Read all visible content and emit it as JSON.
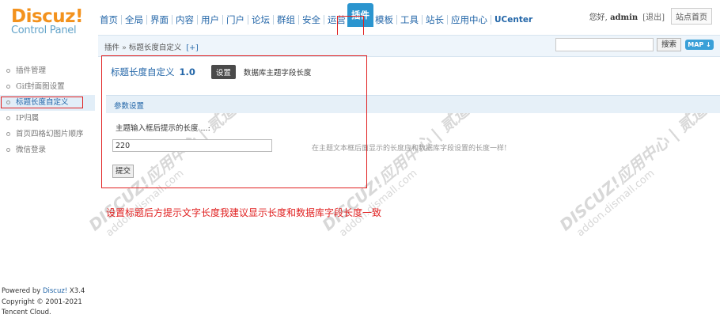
{
  "header": {
    "logo_title": "Discuz!",
    "logo_subtitle": "Control Panel",
    "nav": [
      {
        "label": "首页",
        "active": false
      },
      {
        "label": "全局",
        "active": false
      },
      {
        "label": "界面",
        "active": false
      },
      {
        "label": "内容",
        "active": false
      },
      {
        "label": "用户",
        "active": false
      },
      {
        "label": "门户",
        "active": false
      },
      {
        "label": "论坛",
        "active": false
      },
      {
        "label": "群组",
        "active": false
      },
      {
        "label": "安全",
        "active": false
      },
      {
        "label": "运营",
        "active": false
      },
      {
        "label": "插件",
        "active": true
      },
      {
        "label": "模板",
        "active": false
      },
      {
        "label": "工具",
        "active": false
      },
      {
        "label": "站长",
        "active": false
      },
      {
        "label": "应用中心",
        "active": false
      },
      {
        "label": "UCenter",
        "active": false
      }
    ],
    "welcome_prefix": "您好,",
    "username": "admin",
    "logout": "[退出]",
    "site_home": "站点首页"
  },
  "subbar": {
    "breadcrumb": "插件 » 标题长度自定义",
    "add_label": "[+]",
    "search_value": "",
    "search_button": "搜索",
    "map_button": "MAP ↓"
  },
  "sidebar": {
    "items": [
      {
        "label": "插件管理",
        "active": false
      },
      {
        "label": "Gif封面图设置",
        "active": false
      },
      {
        "label": "标题长度自定义",
        "active": true
      },
      {
        "label": "IP归属",
        "active": false
      },
      {
        "label": "首页四格幻图片顺序",
        "active": false
      },
      {
        "label": "微信登录",
        "active": false
      }
    ],
    "powered_prefix": "Powered by ",
    "powered_name": "Discuz!",
    "powered_version": " X3.4",
    "copyright": "Copyright © 2001-2021",
    "company": "Tencent Cloud."
  },
  "main": {
    "plugin_title": "标题长度自定义",
    "plugin_version": "1.0",
    "tab_settings": "设置",
    "tab_db": "数据库主题字段长度",
    "section_title": "参数设置",
    "field_label": "主题输入框后提示的长度 ...:",
    "field_value": "220",
    "field_tip": "在主题文本框后面显示的长度应和数据库字段设置的长度一样!",
    "submit": "提交",
    "annotation": "设置标题后方提示文字长度我建议显示长度和数据库字段长度一致"
  },
  "watermark": {
    "line1": "DISCUZ!应用中心 | 贰道",
    "line2": "addon.dismall.com"
  },
  "colors": {
    "accent": "#2b95cf",
    "link": "#2366a8",
    "highlight_box": "#e02020",
    "logo_orange": "#f3921d"
  }
}
